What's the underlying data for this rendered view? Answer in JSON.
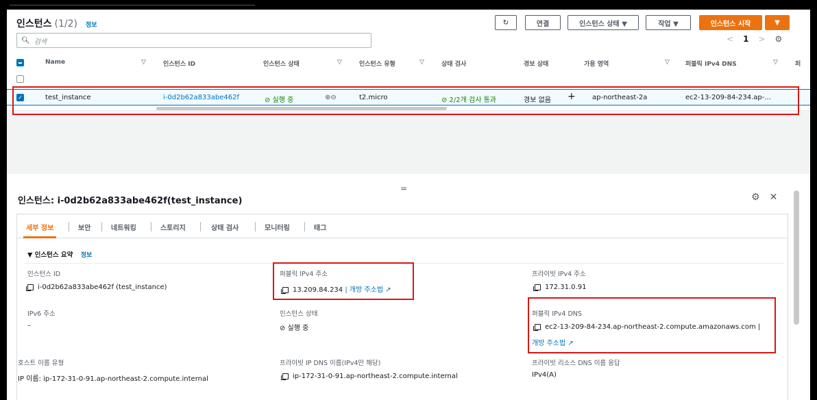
{
  "list": {
    "title": "인스턴스",
    "count": "(1/2)",
    "info": "정보",
    "refresh_icon": "refresh-icon",
    "buttons": {
      "connect": "연결",
      "instance_state": "인스턴스 상태 ▼",
      "actions": "작업 ▼",
      "launch": "인스턴스 시작",
      "launch_dropdown": "▼"
    },
    "search_placeholder": "검색",
    "pager": {
      "prev": "<",
      "page": "1",
      "next": ">"
    },
    "columns": [
      "Name",
      "인스턴스 ID",
      "인스턴스 상태",
      "인스턴스 유형",
      "상태 검사",
      "경보 상태",
      "가용 영역",
      "퍼블릭 IPv4 DNS",
      "퍼"
    ],
    "row": {
      "name": "test_instance",
      "instance_id": "i-0d2b62a833abe462f",
      "state": "⊘ 실행 중",
      "zoom": "⊕⊖",
      "type": "t2.micro",
      "status_check": "⊘ 2/2개 검사 통과",
      "alarm": "경보 없음",
      "alarm_add": "+",
      "az": "ap-northeast-2a",
      "dns": "ec2-13-209-84-234.ap-..."
    }
  },
  "detail": {
    "title": "인스턴스: i-0d2b62a833abe462f(test_instance)",
    "split_handle": "=",
    "tabs": [
      "세부 정보",
      "보안",
      "네트워킹",
      "스토리지",
      "상태 검사",
      "모니터링",
      "태그"
    ],
    "summary": "▼ 인스턴스 요약",
    "summary_info": "정보",
    "fields": {
      "instance_id_label": "인스턴스 ID",
      "instance_id_value": "i-0d2b62a833abe462f (test_instance)",
      "public_ip_label": "퍼블릭 IPv4 주소",
      "public_ip_value": "13.209.84.234",
      "public_ip_open": "| 개방 주소법",
      "private_ip_label": "프라이빗 IPv4 주소",
      "private_ip_value": "172.31.0.91",
      "ipv6_label": "IPv6 주소",
      "ipv6_value": "–",
      "state_label": "인스턴스 상태",
      "state_value": "⊘ 실행 중",
      "public_dns_label": "퍼블릭 IPv4 DNS",
      "public_dns_value": "ec2-13-209-84-234.ap-northeast-2.compute.amazonaws.com |",
      "public_dns_open": "개방 주소법",
      "hostname_type_label": "호스트 이름 유형",
      "hostname_type_value": "IP 이름: ip-172-31-0-91.ap-northeast-2.compute.internal",
      "private_dns_label": "프라이빗 IP DNS 이름(IPv4만 해당)",
      "private_dns_value": "ip-172-31-0-91.ap-northeast-2.compute.internal",
      "private_resource_dns_label": "프라이빗 리소스 DNS 이름 응답",
      "private_resource_dns_value": "IPv4(A)"
    }
  }
}
